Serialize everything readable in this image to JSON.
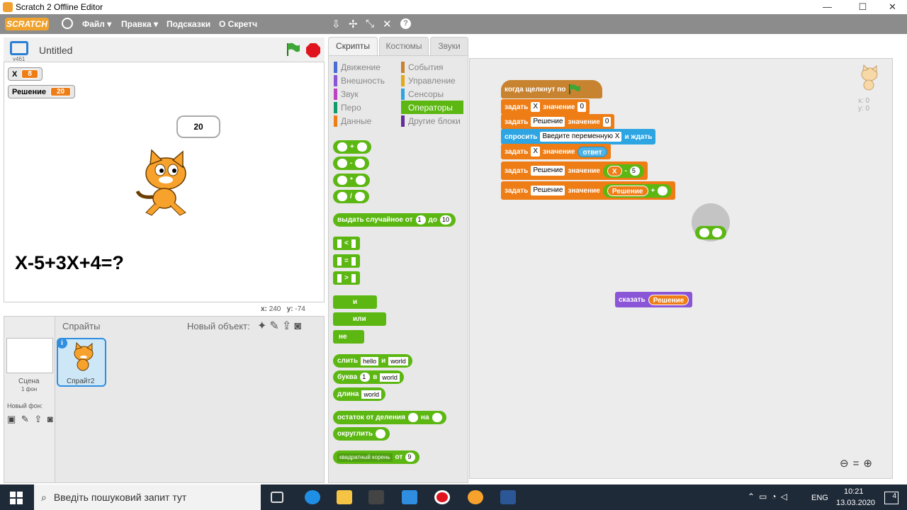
{
  "window": {
    "title": "Scratch 2 Offline Editor",
    "min": "—",
    "max": "☐",
    "close": "✕"
  },
  "menu": {
    "logo": "SCRATCH",
    "items": [
      "Файл ▾",
      "Правка ▾",
      "Подсказки",
      "О Скретч"
    ],
    "tools": [
      "⇩",
      "✢",
      "✕",
      "⤡",
      "?"
    ]
  },
  "stage": {
    "title": "Untitled",
    "version": "v461",
    "monitors": [
      {
        "name": "X",
        "value": "8"
      },
      {
        "name": "Решение",
        "value": "20"
      }
    ],
    "bubble": "20",
    "equation": "X-5+3X+4=?",
    "x_label": "x:",
    "x": "240",
    "y_label": "y:",
    "y": "-74"
  },
  "sprites": {
    "header": "Спрайты",
    "new_object": "Новый объект:",
    "stage_label": "Сцена",
    "stage_sub": "1 фон",
    "new_bg": "Новый фон:",
    "sprite_name": "Спрайт2"
  },
  "tabs": [
    "Скрипты",
    "Костюмы",
    "Звуки"
  ],
  "categories": {
    "left": [
      {
        "label": "Движение",
        "color": "#4a6cd4"
      },
      {
        "label": "Внешность",
        "color": "#8a55d7"
      },
      {
        "label": "Звук",
        "color": "#bb42c3"
      },
      {
        "label": "Перо",
        "color": "#0e9a6c"
      },
      {
        "label": "Данные",
        "color": "#ee7d16"
      }
    ],
    "right": [
      {
        "label": "События",
        "color": "#c88330"
      },
      {
        "label": "Управление",
        "color": "#e1a91a"
      },
      {
        "label": "Сенсоры",
        "color": "#2ca5e2"
      },
      {
        "label": "Операторы",
        "color": "#5cb712"
      },
      {
        "label": "Другие блоки",
        "color": "#632d99"
      }
    ]
  },
  "palette": {
    "ops": [
      "+",
      "-",
      "*",
      "/"
    ],
    "random": "выдать случайное от",
    "rnd_from": "1",
    "rnd_to_label": "до",
    "rnd_to": "10",
    "cmp": [
      "<",
      "=",
      ">"
    ],
    "and": "и",
    "or": "или",
    "not": "не",
    "join": "слить",
    "join_a": "hello",
    "join_and": "и",
    "join_b": "world",
    "letter": "буква",
    "letter_n": "1",
    "letter_in": "в",
    "letter_w": "world",
    "length": "длина",
    "length_w": "world",
    "mod": "остаток от деления",
    "mod_on": "на",
    "round": "округлить",
    "sqrt": "квадратный корень",
    "sqrt_of": "от",
    "sqrt_v": "9"
  },
  "script": {
    "hat": "когда щелкнут по",
    "set": "задать",
    "value": "значение",
    "var_x": "X",
    "var_r": "Решение",
    "zero": "0",
    "ask": "спросить",
    "ask_text": "Введите переменную X",
    "ask_wait": "и ждать",
    "answer": "ответ",
    "minus": "-",
    "five": "5",
    "plus": "+",
    "say": "сказать"
  },
  "sprite_info": {
    "x": "x: 0",
    "y": "y: 0"
  },
  "taskbar": {
    "search": "Введіть пошуковий запит тут",
    "lang": "ENG",
    "time": "10:21",
    "date": "13.03.2020",
    "notif": "4"
  }
}
